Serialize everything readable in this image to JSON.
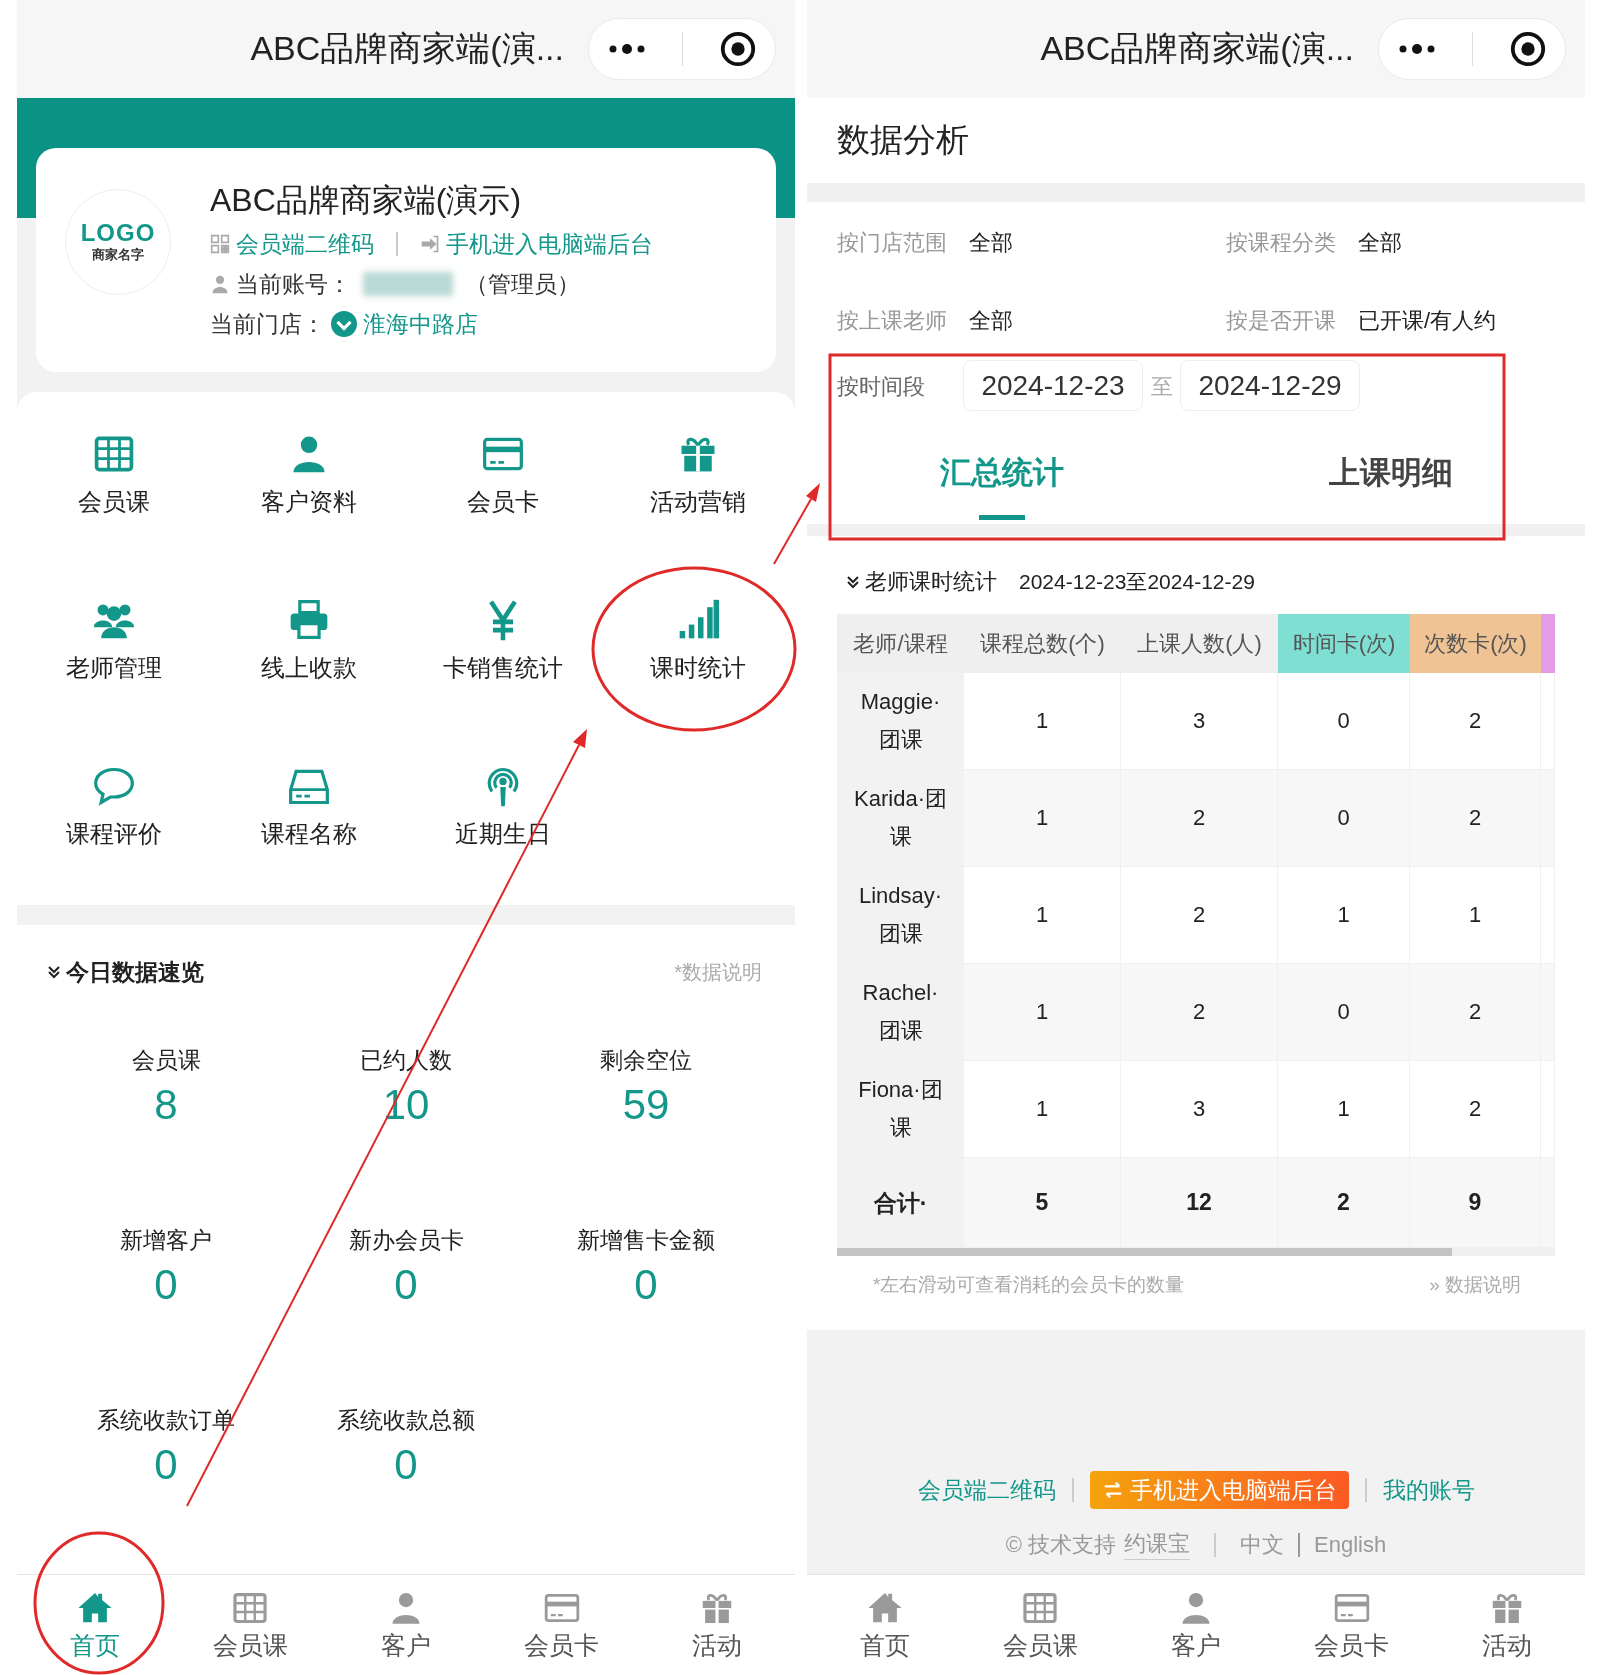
{
  "home_screen": {
    "nav_title": "ABC品牌商家端(演...",
    "store_card": {
      "logo_text": "LOGO",
      "logo_subtext": "商家名字",
      "title": "ABC品牌商家端(演示)",
      "links": [
        "会员端二维码",
        "手机进入电脑端后台"
      ],
      "account_label": "当前账号：",
      "account_role": "（管理员）",
      "store_label": "当前门店：",
      "store_name": "淮海中路店"
    },
    "menu": [
      {
        "label": "会员课"
      },
      {
        "label": "客户资料"
      },
      {
        "label": "会员卡"
      },
      {
        "label": "活动营销"
      },
      {
        "label": "老师管理"
      },
      {
        "label": "线上收款"
      },
      {
        "label": "卡销售统计"
      },
      {
        "label": "课时统计"
      },
      {
        "label": "课程评价"
      },
      {
        "label": "课程名称"
      },
      {
        "label": "近期生日"
      }
    ],
    "today": {
      "title": "今日数据速览",
      "note": "*数据说明",
      "stats": [
        {
          "label": "会员课",
          "value": "8"
        },
        {
          "label": "已约人数",
          "value": "10"
        },
        {
          "label": "剩余空位",
          "value": "59"
        },
        {
          "label": "新增客户",
          "value": "0"
        },
        {
          "label": "新办会员卡",
          "value": "0"
        },
        {
          "label": "新增售卡金额",
          "value": "0"
        },
        {
          "label": "系统收款订单",
          "value": "0"
        },
        {
          "label": "系统收款总额",
          "value": "0"
        }
      ]
    },
    "tab_bar": [
      {
        "label": "首页",
        "selected": true
      },
      {
        "label": "会员课",
        "selected": false
      },
      {
        "label": "客户",
        "selected": false
      },
      {
        "label": "会员卡",
        "selected": false
      },
      {
        "label": "活动",
        "selected": false
      }
    ]
  },
  "analysis_screen": {
    "nav_title": "ABC品牌商家端(演...",
    "page_title": "数据分析",
    "filters": [
      {
        "label": "按门店范围",
        "value": "全部"
      },
      {
        "label": "按课程分类",
        "value": "全部"
      },
      {
        "label": "按上课老师",
        "value": "全部"
      },
      {
        "label": "按是否开课",
        "value": "已开课/有人约"
      }
    ],
    "period": {
      "label": "按时间段",
      "start": "2024-12-23",
      "separator": "至",
      "end": "2024-12-29"
    },
    "tabs": [
      {
        "label": "汇总统计",
        "selected": true
      },
      {
        "label": "上课明细",
        "selected": false
      }
    ],
    "section": {
      "title": "老师课时统计",
      "range": "2024-12-23至2024-12-29"
    },
    "table": {
      "columns": [
        {
          "label": "老师/课程"
        },
        {
          "label": "课程总数(个)"
        },
        {
          "label": "上课人数(人)"
        },
        {
          "label": "时间卡(次)",
          "color": "#7fdfd3"
        },
        {
          "label": "次数卡(次)",
          "color": "#efc394"
        },
        {
          "color": "#e49ce6"
        }
      ],
      "rows": [
        {
          "cells": [
            "Maggie·团课",
            "1",
            "3",
            "0",
            "2"
          ]
        },
        {
          "cells": [
            "Karida·团课",
            "1",
            "2",
            "0",
            "2"
          ]
        },
        {
          "cells": [
            "Lindsay·团课",
            "1",
            "2",
            "1",
            "1"
          ]
        },
        {
          "cells": [
            "Rachel·团课",
            "1",
            "2",
            "0",
            "2"
          ]
        },
        {
          "cells": [
            "Fiona·团课",
            "1",
            "3",
            "1",
            "2"
          ]
        }
      ],
      "total": {
        "cells": [
          "合计·",
          "5",
          "12",
          "2",
          "9"
        ]
      }
    },
    "hint": "*左右滑动可查看消耗的会员卡的数量",
    "data_note": "» 数据说明",
    "footer": {
      "links": [
        {
          "kind": "link",
          "label": "会员端二维码"
        },
        {
          "kind": "button",
          "label": "手机进入电脑端后台"
        },
        {
          "kind": "link",
          "label": "我的账号"
        }
      ],
      "credit": "© 技术支持",
      "brand": "约课宝",
      "languages": [
        "中文",
        "English"
      ]
    },
    "tab_bar": [
      {
        "label": "首页",
        "selected": false
      },
      {
        "label": "会员课",
        "selected": false
      },
      {
        "label": "客户",
        "selected": false
      },
      {
        "label": "会员卡",
        "selected": false
      },
      {
        "label": "活动",
        "selected": false
      }
    ]
  }
}
